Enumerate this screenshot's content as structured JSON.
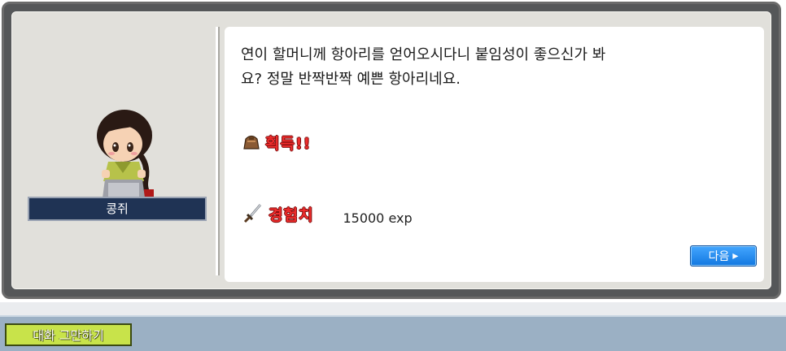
{
  "npc": {
    "name": "콩쥐"
  },
  "dialog": {
    "message": "연이 할머니께 항아리를 얻어오시다니 붙임성이 좋으신가 봐\n요? 정말 반짝반짝 예쁜 항아리네요.",
    "reward_acquire_label": "획득!!",
    "reward_exp_label": "경험치",
    "exp_value": "15000 exp",
    "next_button": "다음",
    "next_arrow": "▸"
  },
  "bottom_bar": {
    "end_chat_button": "대화 그만하기"
  },
  "icons": {
    "acquire": "bag-icon",
    "exp": "sword-icon"
  },
  "colors": {
    "reward_label": "#ef2d2d",
    "next_button": "#1f8cf2",
    "end_chat_button": "#c8e34a",
    "name_plate": "#1f3354"
  }
}
